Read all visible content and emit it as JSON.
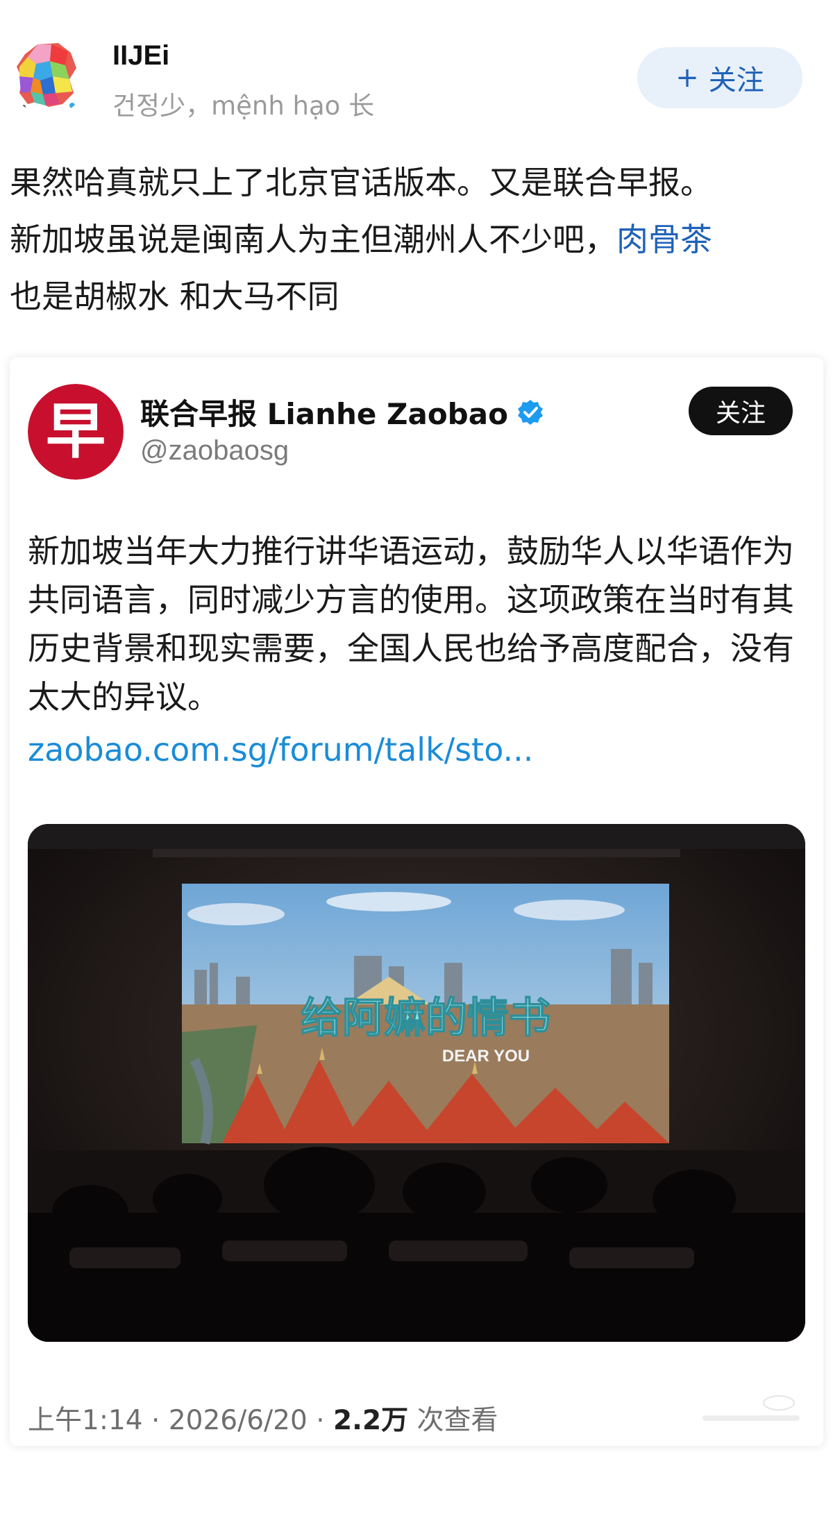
{
  "post": {
    "username": "IIJEi",
    "description": "건정少，mệnh hạo 长",
    "follow_label": "关注",
    "follow_icon": "plus-icon",
    "text_line1": "果然哈真就只上了北京官话版本。又是联合早报。",
    "text_line2_prefix": "新加坡虽说是闽南人为主但潮州人不少吧，",
    "text_line2_link": "肉骨茶",
    "text_line3": "也是胡椒水 和大马不同"
  },
  "quoted": {
    "logo_char": "早",
    "name": "联合早报 Lianhe Zaobao",
    "verified_icon": "verified-badge-icon",
    "handle": "@zaobaosg",
    "follow_label": "关注",
    "text": "新加坡当年大力推行讲华语运动，鼓励华人以华语作为共同语言，同时减少方言的使用。这项政策在当时有其历史背景和现实需要，全国人民也给予高度配合，没有太大的异议。",
    "link": "zaobao.com.sg/forum/talk/sto...",
    "media": {
      "title_text": "给阿嫲的情书",
      "subtitle_text": "DEAR YOU"
    },
    "footer": {
      "time": "上午1:14",
      "sep": "·",
      "date": "2026/6/20",
      "views_count": "2.2万",
      "views_label": "次查看"
    }
  },
  "colors": {
    "link": "#1f62b8",
    "card_link": "#1a8cd8",
    "zaobao_red": "#c8102e",
    "verified_blue": "#1d9bf0"
  }
}
